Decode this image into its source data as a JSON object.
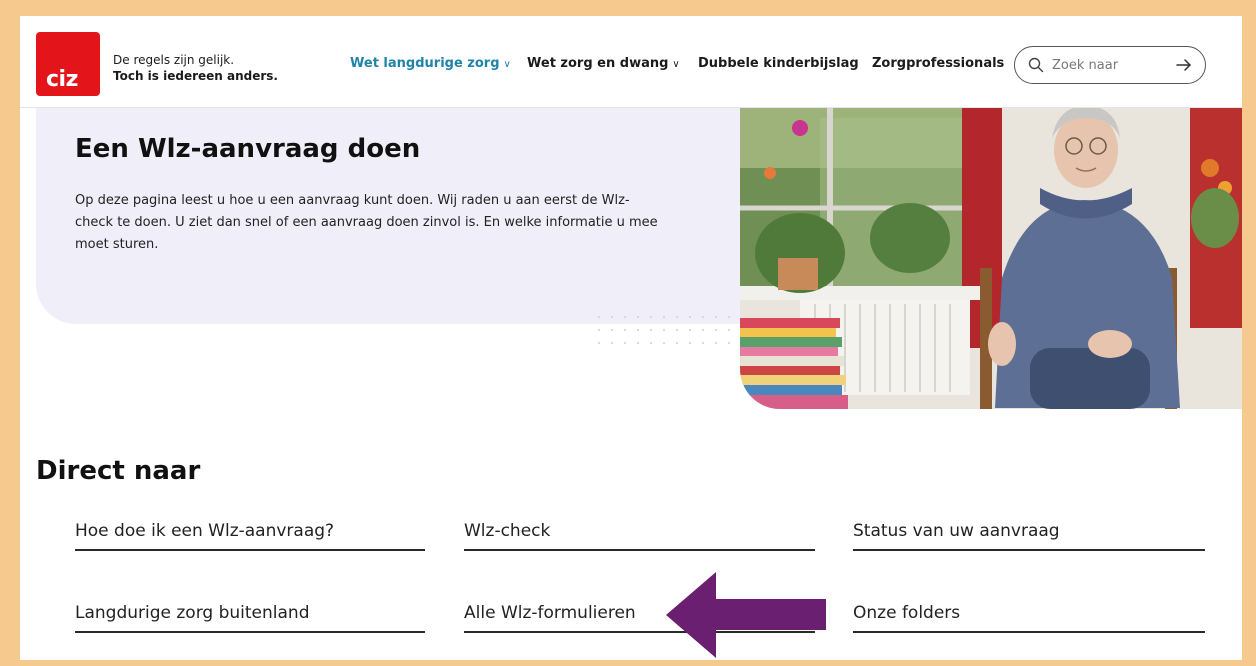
{
  "header": {
    "logo_text": "ciz",
    "tagline_line1": "De regels zijn gelijk.",
    "tagline_line2": "Toch is iedereen anders.",
    "nav": [
      {
        "label": "Wet langdurige zorg",
        "has_dropdown": true,
        "active": true
      },
      {
        "label": "Wet zorg en dwang",
        "has_dropdown": true,
        "active": false
      },
      {
        "label": "Dubbele kinderbijslag",
        "has_dropdown": false,
        "active": false
      },
      {
        "label": "Zorgprofessionals",
        "has_dropdown": false,
        "active": false
      }
    ],
    "search": {
      "placeholder": "Zoek naar",
      "icon": "search-icon",
      "submit_icon": "arrow-right-icon"
    }
  },
  "hero": {
    "title": "Een Wlz-aanvraag doen",
    "text": "Op deze pagina leest u hoe u een aanvraag kunt doen. Wij raden u aan eerst de Wlz-check te doen. U ziet dan snel of een aanvraag doen zinvol is. En welke informatie u mee moet sturen."
  },
  "direct": {
    "title": "Direct naar",
    "links": [
      "Hoe doe ik een Wlz-aanvraag?",
      "Wlz-check",
      "Status van uw aanvraag",
      "Langdurige zorg buitenland",
      "Alle Wlz-formulieren",
      "Onze folders"
    ]
  },
  "colors": {
    "brand_red": "#e3151a",
    "nav_active": "#1f84a8",
    "hero_bg": "#f0eef9",
    "annotation_arrow": "#6b1f70",
    "page_border": "#f6c98e"
  }
}
